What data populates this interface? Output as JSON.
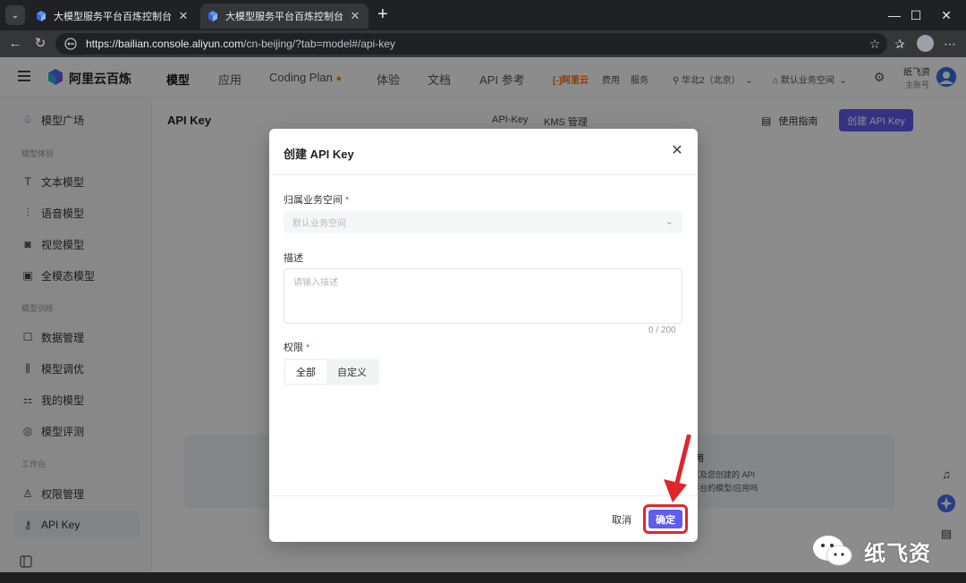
{
  "browser": {
    "tabs": [
      {
        "title": "大模型服务平台百炼控制台",
        "close": "✕"
      },
      {
        "title": "大模型服务平台百炼控制台",
        "close": "✕"
      }
    ],
    "new_tab": "+",
    "url_host": "https://bailian.console.aliyun.com",
    "url_path": "/cn-beijing/?tab=model#/api-key",
    "window_controls": {
      "minimize": "—",
      "maximize": "☐",
      "close": "✕"
    },
    "more": "⋯"
  },
  "topnav": {
    "brand": "阿里云百炼",
    "items": [
      "模型",
      "应用",
      "Coding Plan",
      "体验",
      "文档",
      "API 参考"
    ],
    "active": "模型",
    "aliyun_mark": "[-]阿里云",
    "fee": "费用",
    "service": "服务",
    "region": "华北2（北京）",
    "workspace": "默认业务空间",
    "user_name": "纸飞资",
    "user_sub": "主账号",
    "colors": {
      "accent": "#615ced",
      "aliyun": "#ff6a00"
    }
  },
  "sidebar": {
    "top_item": "模型广场",
    "groups": [
      {
        "label": "模型体验",
        "items": [
          "文本模型",
          "语音模型",
          "视觉模型",
          "全模态模型"
        ]
      },
      {
        "label": "模型训练",
        "items": [
          "数据管理",
          "模型调优",
          "我的模型",
          "模型评测"
        ]
      },
      {
        "label": "工作台",
        "items": [
          "权限管理",
          "API Key"
        ]
      }
    ],
    "selected": "API Key"
  },
  "content": {
    "title": "API Key",
    "tabs": [
      "API-Key",
      "KMS 管理"
    ],
    "guide": "使用指南",
    "create_button": "创建 API Key",
    "ghost_lines": [
      "用",
      "以及您创建的 API",
      "平台的模型/应用吗"
    ]
  },
  "modal": {
    "title": "创建 API Key",
    "workspace_label": "归属业务空间",
    "workspace_value": "默认业务空间",
    "description_label": "描述",
    "description_placeholder": "请输入描述",
    "counter": "0 / 200",
    "permission_label": "权限",
    "permission_options": [
      "全部",
      "自定义"
    ],
    "permission_selected": "全部",
    "cancel": "取消",
    "confirm": "确定",
    "required_mark": "*"
  },
  "watermark_text": "纸飞资"
}
